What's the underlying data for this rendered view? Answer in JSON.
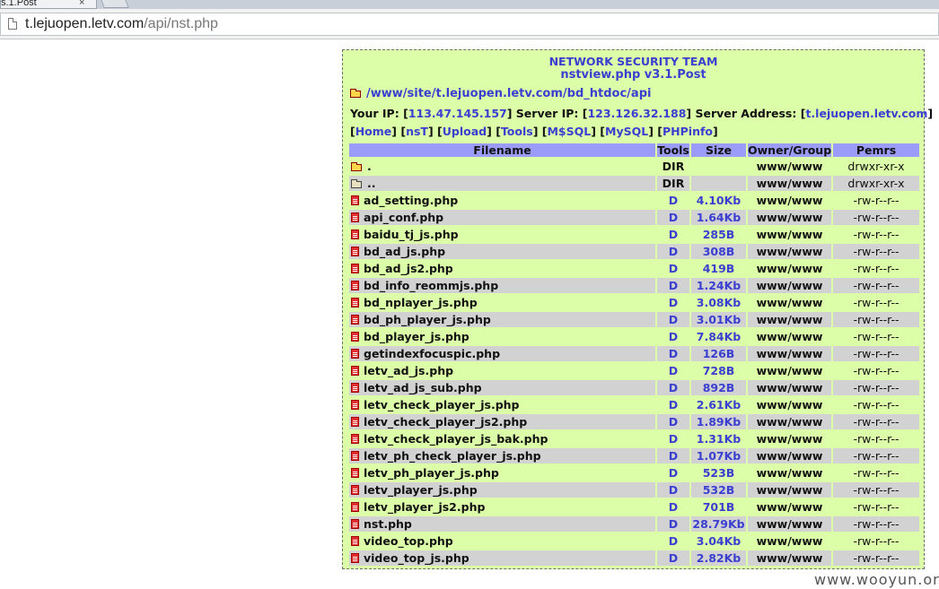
{
  "browser": {
    "tab_title": "s.1.Post",
    "tab_close": "×",
    "url_host": "t.lejuopen.letv.com",
    "url_path": "/api/nst.php"
  },
  "header": {
    "team": "NETWORK SECURITY TEAM",
    "version": "nstview.php v3.1.Post"
  },
  "path": "/www/site/t.lejuopen.letv.com/bd_htdoc/api",
  "info": {
    "your_ip_label": "Your IP:",
    "your_ip": "113.47.145.157",
    "server_ip_label": "Server IP:",
    "server_ip": "123.126.32.188",
    "server_address_label": "Server Address:",
    "server_address": "t.lejuopen.letv.com"
  },
  "nav": [
    "Home",
    "nsT",
    "Upload",
    "Tools",
    "M$SQL",
    "MySQL",
    "PHPinfo"
  ],
  "table": {
    "headers": [
      "Filename",
      "Tools",
      "Size",
      "Owner/Group",
      "Pemrs"
    ],
    "rows": [
      {
        "name": ".",
        "type": "dir",
        "tools": "DIR",
        "size": "",
        "owner": "www/www",
        "perms": "drwxr-xr-x"
      },
      {
        "name": "..",
        "type": "dir",
        "tools": "DIR",
        "size": "",
        "owner": "www/www",
        "perms": "drwxr-xr-x"
      },
      {
        "name": "ad_setting.php",
        "type": "file",
        "tools": "D",
        "size": "4.10Kb",
        "owner": "www/www",
        "perms": "-rw-r--r--"
      },
      {
        "name": "api_conf.php",
        "type": "file",
        "tools": "D",
        "size": "1.64Kb",
        "owner": "www/www",
        "perms": "-rw-r--r--"
      },
      {
        "name": "baidu_tj_js.php",
        "type": "file",
        "tools": "D",
        "size": "285B",
        "owner": "www/www",
        "perms": "-rw-r--r--"
      },
      {
        "name": "bd_ad_js.php",
        "type": "file",
        "tools": "D",
        "size": "308B",
        "owner": "www/www",
        "perms": "-rw-r--r--"
      },
      {
        "name": "bd_ad_js2.php",
        "type": "file",
        "tools": "D",
        "size": "419B",
        "owner": "www/www",
        "perms": "-rw-r--r--"
      },
      {
        "name": "bd_info_reommjs.php",
        "type": "file",
        "tools": "D",
        "size": "1.24Kb",
        "owner": "www/www",
        "perms": "-rw-r--r--"
      },
      {
        "name": "bd_nplayer_js.php",
        "type": "file",
        "tools": "D",
        "size": "3.08Kb",
        "owner": "www/www",
        "perms": "-rw-r--r--"
      },
      {
        "name": "bd_ph_player_js.php",
        "type": "file",
        "tools": "D",
        "size": "3.01Kb",
        "owner": "www/www",
        "perms": "-rw-r--r--"
      },
      {
        "name": "bd_player_js.php",
        "type": "file",
        "tools": "D",
        "size": "7.84Kb",
        "owner": "www/www",
        "perms": "-rw-r--r--"
      },
      {
        "name": "getindexfocuspic.php",
        "type": "file",
        "tools": "D",
        "size": "126B",
        "owner": "www/www",
        "perms": "-rw-r--r--"
      },
      {
        "name": "letv_ad_js.php",
        "type": "file",
        "tools": "D",
        "size": "728B",
        "owner": "www/www",
        "perms": "-rw-r--r--"
      },
      {
        "name": "letv_ad_js_sub.php",
        "type": "file",
        "tools": "D",
        "size": "892B",
        "owner": "www/www",
        "perms": "-rw-r--r--"
      },
      {
        "name": "letv_check_player_js.php",
        "type": "file",
        "tools": "D",
        "size": "2.61Kb",
        "owner": "www/www",
        "perms": "-rw-r--r--"
      },
      {
        "name": "letv_check_player_js2.php",
        "type": "file",
        "tools": "D",
        "size": "1.89Kb",
        "owner": "www/www",
        "perms": "-rw-r--r--"
      },
      {
        "name": "letv_check_player_js_bak.php",
        "type": "file",
        "tools": "D",
        "size": "1.31Kb",
        "owner": "www/www",
        "perms": "-rw-r--r--"
      },
      {
        "name": "letv_ph_check_player_js.php",
        "type": "file",
        "tools": "D",
        "size": "1.07Kb",
        "owner": "www/www",
        "perms": "-rw-r--r--"
      },
      {
        "name": "letv_ph_player_js.php",
        "type": "file",
        "tools": "D",
        "size": "523B",
        "owner": "www/www",
        "perms": "-rw-r--r--"
      },
      {
        "name": "letv_player_js.php",
        "type": "file",
        "tools": "D",
        "size": "532B",
        "owner": "www/www",
        "perms": "-rw-r--r--"
      },
      {
        "name": "letv_player_js2.php",
        "type": "file",
        "tools": "D",
        "size": "701B",
        "owner": "www/www",
        "perms": "-rw-r--r--"
      },
      {
        "name": "nst.php",
        "type": "file",
        "tools": "D",
        "size": "28.79Kb",
        "owner": "www/www",
        "perms": "-rw-r--r--"
      },
      {
        "name": "video_top.php",
        "type": "file",
        "tools": "D",
        "size": "3.04Kb",
        "owner": "www/www",
        "perms": "-rw-r--r--"
      },
      {
        "name": "video_top_js.php",
        "type": "file",
        "tools": "D",
        "size": "2.82Kb",
        "owner": "www/www",
        "perms": "-rw-r--r--"
      }
    ]
  },
  "watermark": "www.wooyun.org",
  "colors": {
    "panel_bg": "#dcfea8",
    "stripe": "#d2d2d2",
    "header_bg": "#9b9bf9",
    "link": "#3a3fd0",
    "file_icon": "#e23030",
    "folder_icon": "#ffd54a"
  },
  "icons": {
    "folder": "folder-icon",
    "file": "file-icon",
    "page": "page-icon"
  }
}
